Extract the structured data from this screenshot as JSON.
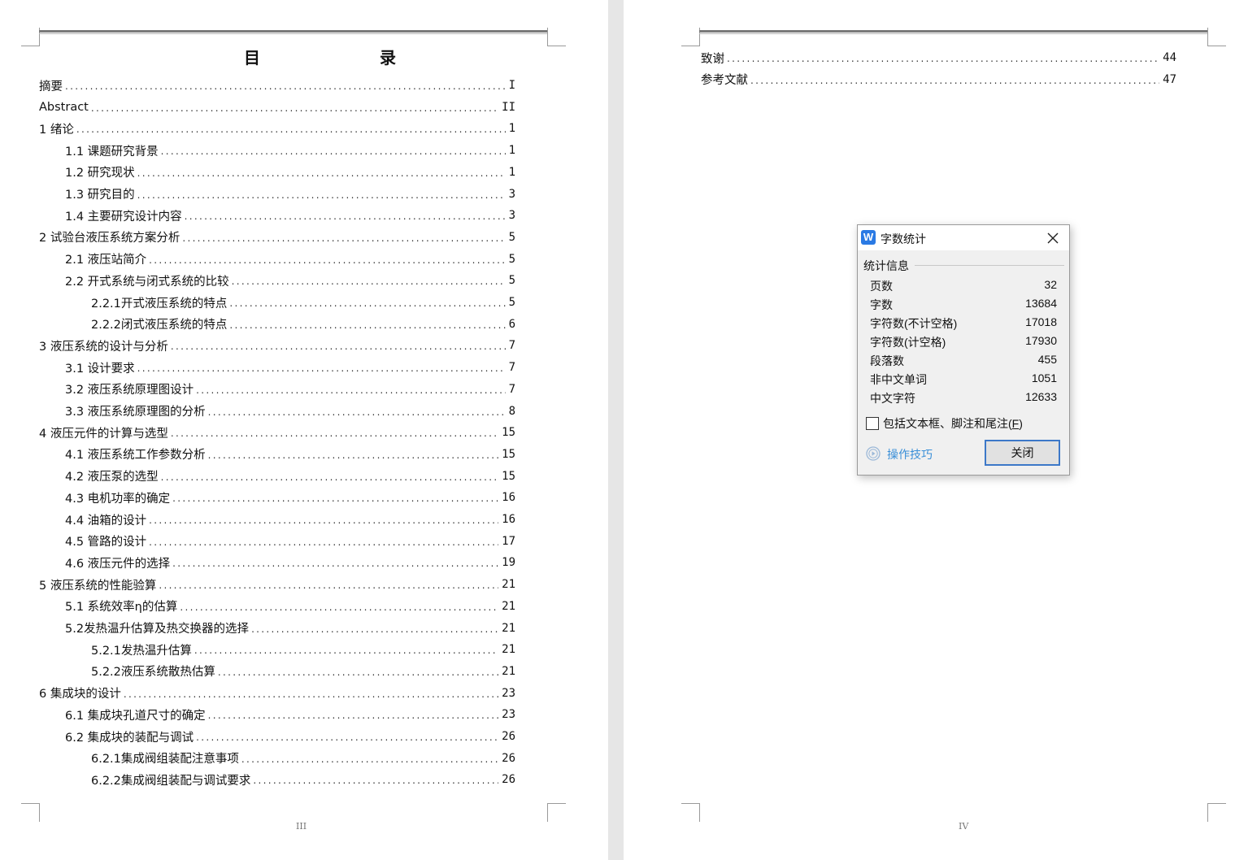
{
  "left_page": {
    "title": "目 录",
    "page_number": "III",
    "entries": [
      {
        "label": "摘要",
        "page": "I",
        "level": 1
      },
      {
        "label": "Abstract",
        "page": "II",
        "level": 1
      },
      {
        "label": "1 绪论",
        "page": "1",
        "level": 1
      },
      {
        "label": "1.1 课题研究背景",
        "page": "1",
        "level": 2
      },
      {
        "label": "1.2 研究现状",
        "page": "1",
        "level": 2
      },
      {
        "label": "1.3 研究目的",
        "page": "3",
        "level": 2
      },
      {
        "label": "1.4 主要研究设计内容",
        "page": "3",
        "level": 2
      },
      {
        "label": "2 试验台液压系统方案分析",
        "page": "5",
        "level": 1
      },
      {
        "label": "2.1 液压站简介",
        "page": "5",
        "level": 2
      },
      {
        "label": "2.2 开式系统与闭式系统的比较",
        "page": "5",
        "level": 2
      },
      {
        "label": "2.2.1开式液压系统的特点",
        "page": "5",
        "level": 3
      },
      {
        "label": "2.2.2闭式液压系统的特点",
        "page": "6",
        "level": 3
      },
      {
        "label": "3 液压系统的设计与分析",
        "page": "7",
        "level": 1
      },
      {
        "label": "3.1 设计要求",
        "page": "7",
        "level": 2
      },
      {
        "label": "3.2 液压系统原理图设计",
        "page": "7",
        "level": 2
      },
      {
        "label": "3.3 液压系统原理图的分析",
        "page": "8",
        "level": 2
      },
      {
        "label": "4 液压元件的计算与选型",
        "page": "15",
        "level": 1
      },
      {
        "label": "4.1 液压系统工作参数分析",
        "page": "15",
        "level": 2
      },
      {
        "label": "4.2 液压泵的选型",
        "page": "15",
        "level": 2
      },
      {
        "label": "4.3 电机功率的确定",
        "page": "16",
        "level": 2
      },
      {
        "label": "4.4 油箱的设计",
        "page": "16",
        "level": 2
      },
      {
        "label": "4.5 管路的设计",
        "page": "17",
        "level": 2
      },
      {
        "label": "4.6 液压元件的选择",
        "page": "19",
        "level": 2
      },
      {
        "label": "5 液压系统的性能验算",
        "page": "21",
        "level": 1
      },
      {
        "label": "5.1 系统效率η的估算",
        "page": "21",
        "level": 2
      },
      {
        "label": "5.2发热温升估算及热交换器的选择",
        "page": "21",
        "level": 2
      },
      {
        "label": "5.2.1发热温升估算",
        "page": "21",
        "level": 3
      },
      {
        "label": "5.2.2液压系统散热估算",
        "page": "21",
        "level": 3
      },
      {
        "label": "6 集成块的设计",
        "page": "23",
        "level": 1
      },
      {
        "label": "6.1 集成块孔道尺寸的确定",
        "page": "23",
        "level": 2
      },
      {
        "label": "6.2 集成块的装配与调试",
        "page": "26",
        "level": 2
      },
      {
        "label": "6.2.1集成阀组装配注意事项",
        "page": "26",
        "level": 3
      },
      {
        "label": "6.2.2集成阀组装配与调试要求",
        "page": "26",
        "level": 3
      }
    ]
  },
  "right_page": {
    "page_number": "IV",
    "entries": [
      {
        "label": "致谢",
        "page": "44",
        "level": 1
      },
      {
        "label": "参考文献",
        "page": "47",
        "level": 1
      }
    ]
  },
  "dialog": {
    "title": "字数统计",
    "logo_letter": "W",
    "group_label": "统计信息",
    "stats": [
      {
        "label": "页数",
        "value": "32"
      },
      {
        "label": "字数",
        "value": "13684"
      },
      {
        "label": "字符数(不计空格)",
        "value": "17018"
      },
      {
        "label": "字符数(计空格)",
        "value": "17930"
      },
      {
        "label": "段落数",
        "value": "455"
      },
      {
        "label": "非中文单词",
        "value": "1051"
      },
      {
        "label": "中文字符",
        "value": "12633"
      }
    ],
    "checkbox_label": "包括文本框、脚注和尾注(",
    "checkbox_hotkey": "F",
    "checkbox_suffix": ")",
    "checkbox_checked": false,
    "tips_label": "操作技巧",
    "close_button": "关闭",
    "colors": {
      "accent": "#3c78c8",
      "link": "#3a8fd8",
      "background": "#f0f0f0"
    }
  },
  "icons": {
    "close": "close-icon",
    "logo": "wps-logo-icon",
    "tips": "play-circle-icon"
  }
}
